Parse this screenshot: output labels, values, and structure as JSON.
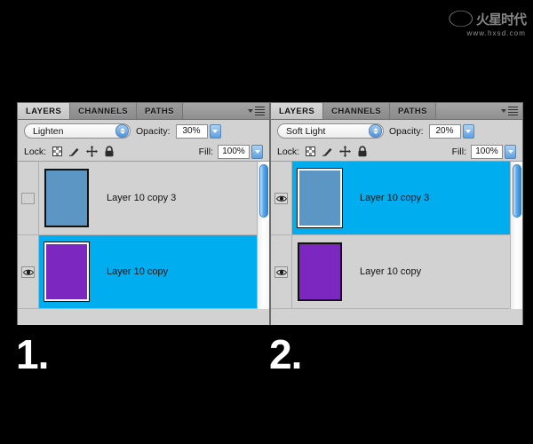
{
  "watermark": {
    "brand_cn": "火星时代",
    "url": "www.hxsd.com",
    "swoosh": "swoosh-mark"
  },
  "steps": [
    {
      "label": "1."
    },
    {
      "label": "2."
    }
  ],
  "colors": {
    "panel_bg": "#d2d2d2",
    "selection_blue": "#00adef",
    "thumb_blue": "#5b96c4",
    "thumb_purple": "#7c28c0",
    "tab_active_bg": "#d0d0d0",
    "tab_inactive_bg": "#969696",
    "scrollbar_thumb": "#5aa9ef",
    "canvas_bg": "#000000"
  },
  "panels": [
    {
      "id": "panel-1",
      "tabs": [
        {
          "label": "LAYERS",
          "active": true
        },
        {
          "label": "CHANNELS",
          "active": false
        },
        {
          "label": "PATHS",
          "active": false
        }
      ],
      "menu_icon": "panel-menu-icon",
      "blend_mode": "Lighten",
      "opacity_label": "Opacity:",
      "opacity_value": "30%",
      "lock_label": "Lock:",
      "lock_icons": [
        "lock-transparency-icon",
        "lock-image-icon",
        "lock-position-icon",
        "lock-all-icon"
      ],
      "fill_label": "Fill:",
      "fill_value": "100%",
      "layers": [
        {
          "name": "Layer 10 copy 3",
          "visible": false,
          "selected": false,
          "thumb_color": "#5b96c4"
        },
        {
          "name": "Layer 10 copy",
          "visible": true,
          "selected": true,
          "thumb_color": "#7c28c0"
        }
      ]
    },
    {
      "id": "panel-2",
      "tabs": [
        {
          "label": "LAYERS",
          "active": true
        },
        {
          "label": "CHANNELS",
          "active": false
        },
        {
          "label": "PATHS",
          "active": false
        }
      ],
      "menu_icon": "panel-menu-icon",
      "blend_mode": "Soft Light",
      "opacity_label": "Opacity:",
      "opacity_value": "20%",
      "lock_label": "Lock:",
      "lock_icons": [
        "lock-transparency-icon",
        "lock-image-icon",
        "lock-position-icon",
        "lock-all-icon"
      ],
      "fill_label": "Fill:",
      "fill_value": "100%",
      "layers": [
        {
          "name": "Layer 10 copy 3",
          "visible": true,
          "selected": true,
          "thumb_color": "#5b96c4"
        },
        {
          "name": "Layer 10 copy",
          "visible": true,
          "selected": false,
          "thumb_color": "#7c28c0"
        }
      ]
    }
  ]
}
